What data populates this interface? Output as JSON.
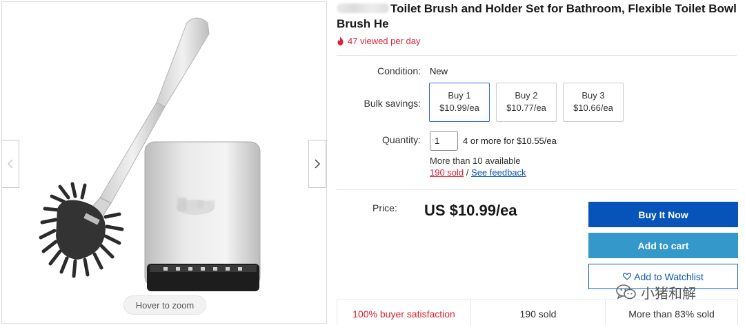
{
  "gallery": {
    "zoom_hint": "Hover to zoom",
    "icons": [
      "chevron-left-icon",
      "chevron-right-icon"
    ]
  },
  "listing": {
    "title": "Toilet Brush and Holder Set for Bathroom, Flexible Toilet Bowl Brush He",
    "views": "47 viewed per day"
  },
  "details": {
    "condition_label": "Condition:",
    "condition_value": "New",
    "bulk_label": "Bulk savings:",
    "bulk_options": [
      {
        "qty": "Buy 1",
        "price": "$10.99/ea",
        "selected": true
      },
      {
        "qty": "Buy 2",
        "price": "$10.77/ea",
        "selected": false
      },
      {
        "qty": "Buy 3",
        "price": "$10.66/ea",
        "selected": false
      }
    ],
    "quantity_label": "Quantity:",
    "quantity_value": "1",
    "quantity_offer": "4 or more for $10.55/ea",
    "availability": "More than 10 available",
    "sold_link": "190 sold",
    "separator": "/",
    "feedback_link": "See feedback"
  },
  "purchase": {
    "price_label": "Price:",
    "price": "US $10.99/ea",
    "buy_now": "Buy It Now",
    "add_to_cart": "Add to cart",
    "watchlist": "Add to Watchlist"
  },
  "stats": {
    "satisfaction": "100% buyer satisfaction",
    "sold": "190 sold",
    "more_than": "More than 83% sold"
  },
  "watermark": {
    "text": "小猪和解"
  },
  "colors": {
    "accent_red": "#e0213a",
    "buy_blue": "#0654ba",
    "cart_blue": "#3498ca",
    "selected_border": "#3665f3",
    "link_blue": "#0654ba"
  }
}
